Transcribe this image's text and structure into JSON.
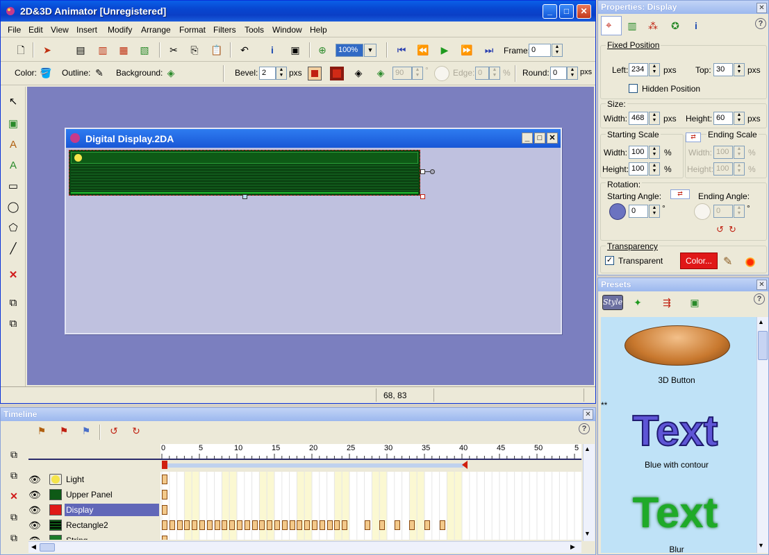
{
  "app": {
    "title": "2D&3D Animator [Unregistered]"
  },
  "menu": [
    "File",
    "Edit",
    "View",
    "Insert",
    "Modify",
    "Arrange",
    "Format",
    "Filters",
    "Tools",
    "Window",
    "Help"
  ],
  "toolbar1": {
    "zoom": "100%",
    "frame_label": "Frame:",
    "frame_value": "0"
  },
  "toolbar2": {
    "color_label": "Color:",
    "outline_label": "Outline:",
    "background_label": "Background:",
    "bevel_label": "Bevel:",
    "bevel_value": "2",
    "bevel_unit": "pxs",
    "angle_value": "90",
    "angle_unit": "°",
    "edge_label": "Edge:",
    "edge_value": "0",
    "edge_unit": "%",
    "round_label": "Round:",
    "round_value": "0",
    "round_unit": "pxs"
  },
  "document": {
    "title": "Digital Display.2DA"
  },
  "status": {
    "coords": "68, 83"
  },
  "timeline": {
    "title": "Timeline",
    "ruler_labels": [
      "0",
      "5",
      "10",
      "15",
      "20",
      "25",
      "30",
      "35",
      "40",
      "45",
      "50",
      "5"
    ],
    "layers": [
      {
        "name": "Light",
        "swatch": "#f5e44a",
        "shape": "circle"
      },
      {
        "name": "Upper Panel",
        "swatch": "#0e5a16",
        "shape": "rect"
      },
      {
        "name": "Display",
        "swatch": "#e01818",
        "shape": "rect",
        "selected": true
      },
      {
        "name": "Rectangle2",
        "swatch": "#0a3f10",
        "shape": "rect"
      },
      {
        "name": "String",
        "swatch": "#1c7a2a",
        "shape": "rect"
      }
    ]
  },
  "properties": {
    "title": "Properties: Display",
    "fixed_position_title": "Fixed Position",
    "left_label": "Left:",
    "left_value": "234",
    "top_label": "Top:",
    "top_value": "30",
    "px_unit": "pxs",
    "hidden_position_label": "Hidden Position",
    "size_title": "Size:",
    "width_label": "Width:",
    "width_value": "468",
    "height_label": "Height:",
    "height_value": "60",
    "starting_scale_title": "Starting Scale",
    "ending_scale_title": "Ending Scale",
    "start_scale_width": "100",
    "start_scale_height": "100",
    "end_scale_width": "100",
    "end_scale_height": "100",
    "percent": "%",
    "rotation_title": "Rotation:",
    "starting_angle_label": "Starting Angle:",
    "ending_angle_label": "Ending Angle:",
    "starting_angle": "0",
    "ending_angle": "0",
    "degree": "°",
    "transparency_title": "Transparency",
    "transparent_label": "Transparent",
    "transparent_checked": true,
    "color_button": "Color..."
  },
  "presets": {
    "title": "Presets",
    "style_tab": "Style",
    "items": [
      {
        "label": "3D Button"
      },
      {
        "label": "Blue with contour",
        "preview_text": "Text"
      },
      {
        "label": "Blur",
        "preview_text": "Text"
      }
    ]
  }
}
